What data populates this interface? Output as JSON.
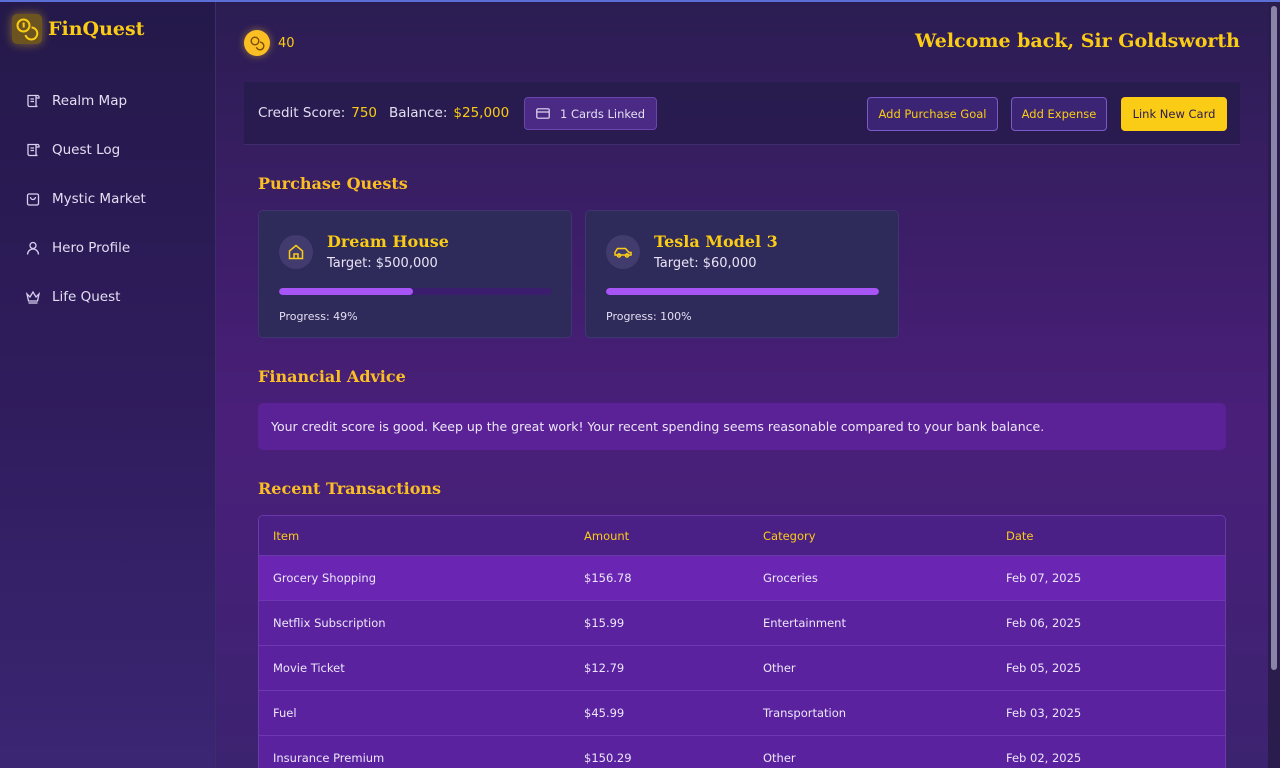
{
  "app": {
    "name": "FinQuest",
    "coins": "40",
    "welcome": "Welcome back, Sir Goldsworth"
  },
  "sidebar": {
    "items": [
      {
        "label": "Realm Map",
        "icon": "scroll-icon"
      },
      {
        "label": "Quest Log",
        "icon": "scroll-icon"
      },
      {
        "label": "Mystic Market",
        "icon": "shopping-bag-icon"
      },
      {
        "label": "Hero Profile",
        "icon": "user-icon"
      },
      {
        "label": "Life Quest",
        "icon": "crown-icon"
      }
    ]
  },
  "stats": {
    "credit_label": "Credit Score:",
    "credit_value": "750",
    "balance_label": "Balance:",
    "balance_value": "$25,000",
    "cards_linked": "1 Cards Linked"
  },
  "actions": {
    "add_purchase_goal": "Add Purchase Goal",
    "add_expense": "Add Expense",
    "link_new_card": "Link New Card"
  },
  "quests": {
    "title": "Purchase Quests",
    "items": [
      {
        "name": "Dream House",
        "target": "Target: $500,000",
        "progress_label": "Progress: 49%",
        "progress": 0.49,
        "icon": "house-icon"
      },
      {
        "name": "Tesla Model 3",
        "target": "Target: $60,000",
        "progress_label": "Progress: 100%",
        "progress": 1.0,
        "icon": "car-icon"
      }
    ]
  },
  "advice": {
    "title": "Financial Advice",
    "text": "Your credit score is good. Keep up the great work! Your recent spending seems reasonable compared to your bank balance."
  },
  "transactions": {
    "title": "Recent Transactions",
    "headers": [
      "Item",
      "Amount",
      "Category",
      "Date"
    ],
    "rows": [
      [
        "Grocery Shopping",
        "$156.78",
        "Groceries",
        "Feb 07, 2025"
      ],
      [
        "Netflix Subscription",
        "$15.99",
        "Entertainment",
        "Feb 06, 2025"
      ],
      [
        "Movie Ticket",
        "$12.79",
        "Other",
        "Feb 05, 2025"
      ],
      [
        "Fuel",
        "$45.99",
        "Transportation",
        "Feb 03, 2025"
      ],
      [
        "Insurance Premium",
        "$150.29",
        "Other",
        "Feb 02, 2025"
      ]
    ]
  },
  "colors": {
    "accent": "#facc15",
    "progress": "#a855f7",
    "background": "#4a1f7a"
  }
}
